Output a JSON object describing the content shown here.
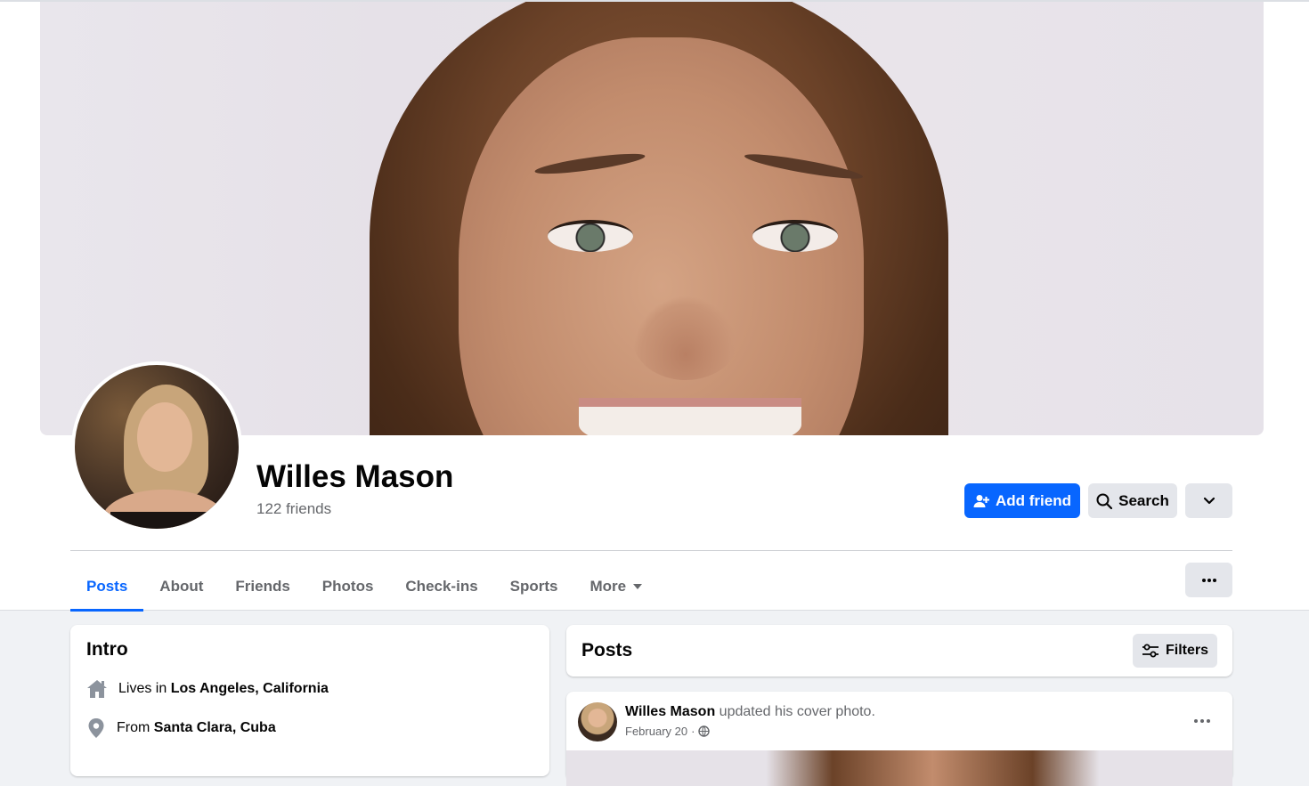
{
  "profile": {
    "name": "Willes Mason",
    "friends": "122 friends"
  },
  "actions": {
    "add_friend": "Add friend",
    "search": "Search"
  },
  "tabs": [
    {
      "label": "Posts",
      "active": true
    },
    {
      "label": "About"
    },
    {
      "label": "Friends"
    },
    {
      "label": "Photos"
    },
    {
      "label": "Check-ins"
    },
    {
      "label": "Sports"
    },
    {
      "label": "More"
    }
  ],
  "intro": {
    "title": "Intro",
    "lives_prefix": "Lives in ",
    "lives_value": "Los Angeles, California",
    "from_prefix": "From ",
    "from_value": "Santa Clara, Cuba"
  },
  "posts": {
    "title": "Posts",
    "filters_label": "Filters"
  },
  "post": {
    "author": "Willes Mason",
    "action": " updated his cover photo.",
    "date": "February 20",
    "separator": "·"
  },
  "colors": {
    "accent": "#0866ff",
    "secondary_button": "#e4e6eb",
    "muted_text": "#65676b",
    "page_bg": "#f0f2f5"
  },
  "icons": [
    "add-user-icon",
    "search-icon",
    "chevron-down-icon",
    "more-icon",
    "home-icon",
    "location-pin-icon",
    "filters-icon",
    "globe-icon",
    "caret-down-icon"
  ]
}
